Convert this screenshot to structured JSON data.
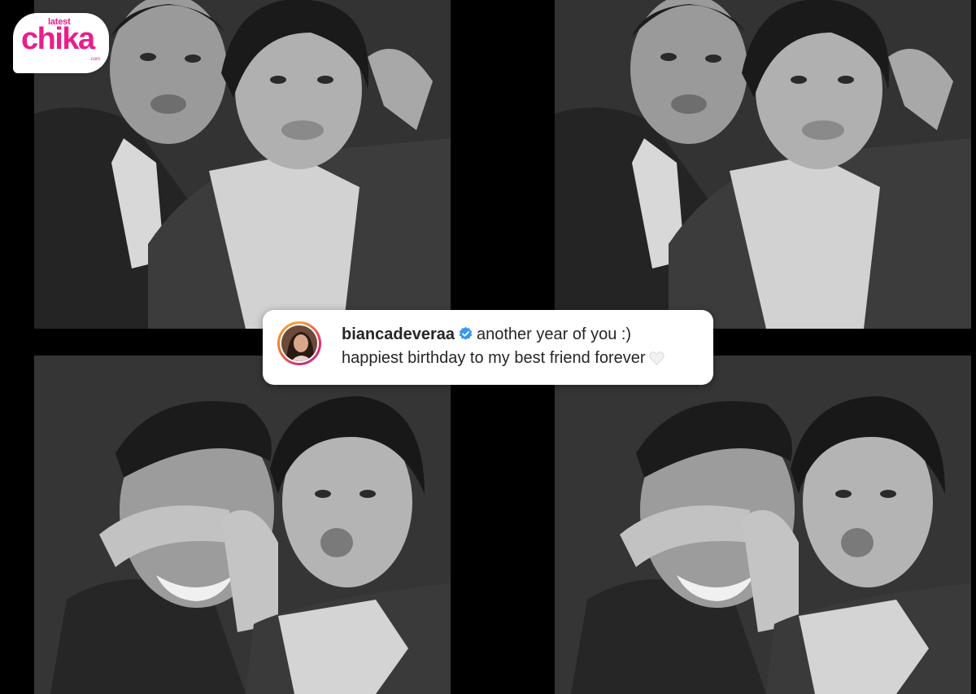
{
  "logo": {
    "small_text": "latest",
    "main_text": "chika",
    "suffix_text": ".com",
    "color": "#e91e8c"
  },
  "caption": {
    "username": "biancadeveraa",
    "line1_text": "another year of you :)",
    "line2_text": "happiest birthday to my best friend forever",
    "verified_icon": "verified-badge-icon",
    "heart_icon": "white-heart-icon",
    "verified_color": "#3897f0"
  },
  "photos": [
    {
      "description_key": "photo-1"
    },
    {
      "description_key": "photo-2"
    },
    {
      "description_key": "photo-3"
    },
    {
      "description_key": "photo-4"
    }
  ]
}
